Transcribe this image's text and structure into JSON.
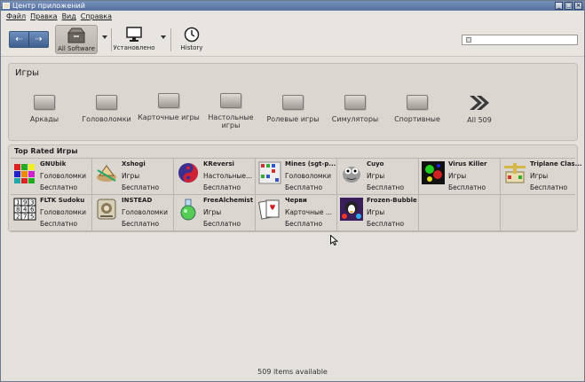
{
  "window": {
    "title": "Центр приложений"
  },
  "menu": [
    "Файл",
    "Правка",
    "Вид",
    "Справка"
  ],
  "toolbar": {
    "back": "⇠",
    "forward": "⇢",
    "all_software": "All Software",
    "installed": "Установлено",
    "history": "History"
  },
  "categories_panel": {
    "title": "Игры",
    "items": [
      {
        "label": "Аркады"
      },
      {
        "label": "Головоломки"
      },
      {
        "label": "Карточные игры"
      },
      {
        "label": "Настольные игры"
      },
      {
        "label": "Ролевые игры"
      },
      {
        "label": "Симуляторы"
      },
      {
        "label": "Спортивные"
      },
      {
        "label": "All 509"
      }
    ]
  },
  "top_rated": {
    "title": "Top Rated Игры",
    "apps": [
      {
        "name": "GNUbik",
        "category": "Головоломки",
        "price": "Бесплатно",
        "icon": "cube-icon"
      },
      {
        "name": "Xshogi",
        "category": "Игры",
        "price": "Бесплатно",
        "icon": "shogi-icon"
      },
      {
        "name": "KReversi",
        "category": "Настольные...",
        "price": "Бесплатно",
        "icon": "reversi-icon"
      },
      {
        "name": "Mines (sgt-p...",
        "category": "Головоломки",
        "price": "Бесплатно",
        "icon": "mines-icon"
      },
      {
        "name": "Cuyo",
        "category": "Игры",
        "price": "Бесплатно",
        "icon": "cuyo-icon"
      },
      {
        "name": "Virus Killer",
        "category": "Игры",
        "price": "Бесплатно",
        "icon": "virus-icon"
      },
      {
        "name": "Triplane Clas...",
        "category": "Игры",
        "price": "Бесплатно",
        "icon": "triplane-icon"
      },
      {
        "name": "FLTK Sudoku",
        "category": "Головоломки",
        "price": "Бесплатно",
        "icon": "sudoku-icon"
      },
      {
        "name": "INSTEAD",
        "category": "Головоломки",
        "price": "Бесплатно",
        "icon": "instead-icon"
      },
      {
        "name": "FreeAlchemist",
        "category": "Игры",
        "price": "Бесплатно",
        "icon": "flask-icon"
      },
      {
        "name": "Черви",
        "category": "Карточные ...",
        "price": "Бесплатно",
        "icon": "cards-icon"
      },
      {
        "name": "Frozen-Bubble",
        "category": "Игры",
        "price": "Бесплатно",
        "icon": "frozen-bubble-icon"
      }
    ]
  },
  "status": {
    "text": "509 items available"
  }
}
